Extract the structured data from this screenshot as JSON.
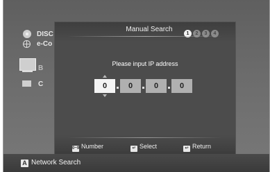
{
  "sidebar": {
    "items": [
      {
        "label": "DISC",
        "icon": "disc-icon"
      },
      {
        "label": "e-Co",
        "icon": "globe-icon"
      },
      {
        "label": "B",
        "icon": "monitor-icon"
      },
      {
        "label": "C",
        "icon": "small-monitor-icon"
      }
    ]
  },
  "dialog": {
    "title": "Manual Search",
    "steps": [
      "1",
      "2",
      "3",
      "4"
    ],
    "active_step": 1,
    "prompt": "Please input IP address",
    "ip_octets": [
      "0",
      "0",
      "0",
      "0"
    ],
    "active_octet": 0,
    "hints": [
      {
        "key": "0~9",
        "label": "Number"
      },
      {
        "key": "↵",
        "label": "Select"
      },
      {
        "key": "↩",
        "label": "Return"
      }
    ]
  },
  "bottom_bar": {
    "key": "A",
    "label": "Network Search"
  },
  "colors": {
    "background": "#666666",
    "dialog": "#4c4c4c",
    "active_field": "#f4f4f4",
    "inactive_field": "#b0b0b0"
  }
}
